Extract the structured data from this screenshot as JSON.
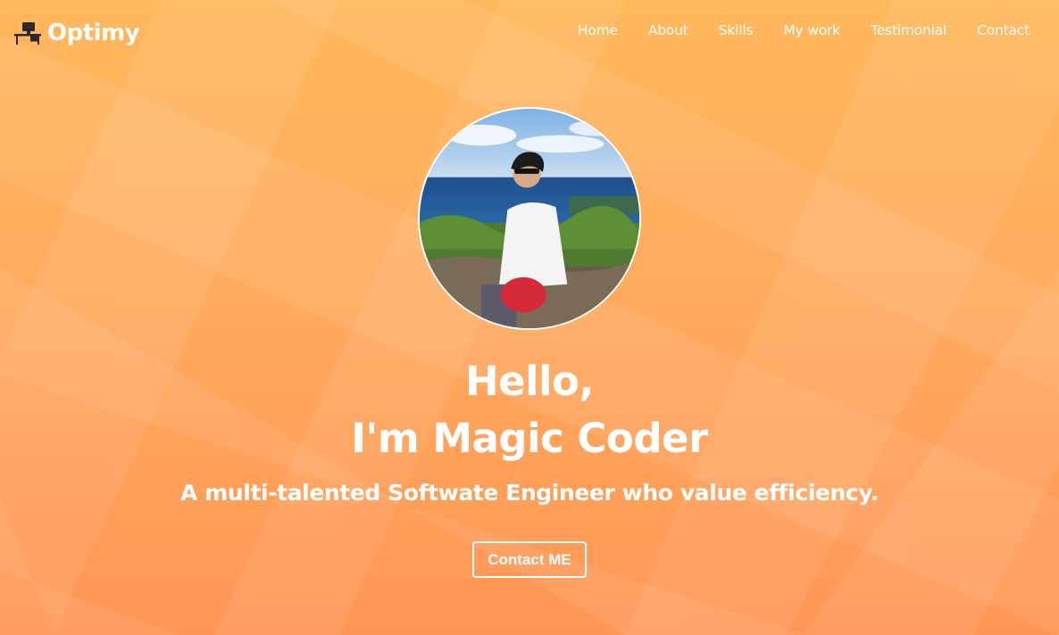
{
  "brand": {
    "name": "Optimy",
    "logo_icon": "desk-computer-icon"
  },
  "nav": {
    "items": [
      {
        "label": "Home"
      },
      {
        "label": "About"
      },
      {
        "label": "Skills"
      },
      {
        "label": "My work"
      },
      {
        "label": "Testimonial"
      },
      {
        "label": "Contact"
      }
    ]
  },
  "hero": {
    "greeting": "Hello,",
    "name_line": "I'm Magic Coder",
    "tagline": "A multi-talented Softwate Engineer who value efficiency.",
    "cta_label": "Contact ME"
  },
  "colors": {
    "gradient_top": "#ffb85c",
    "gradient_bottom": "#ff9656",
    "text": "#ffffff"
  }
}
